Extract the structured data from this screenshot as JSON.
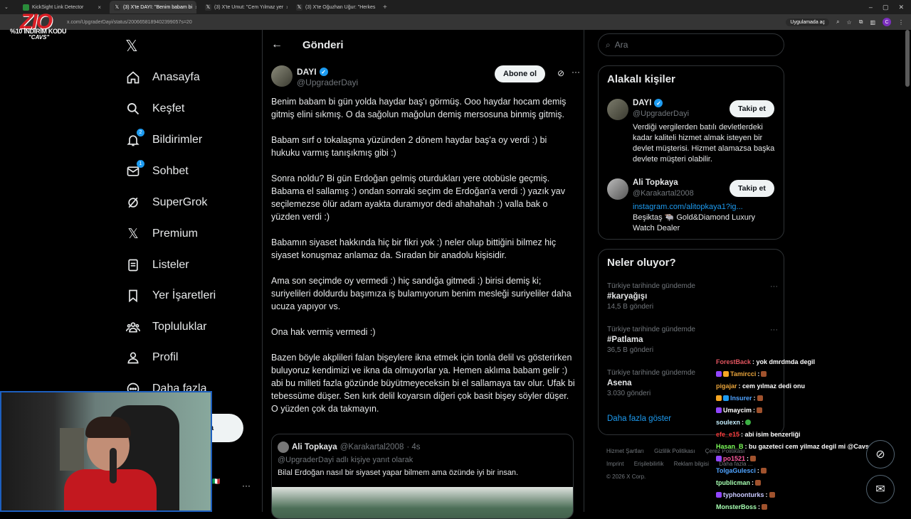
{
  "browser": {
    "tabs": [
      {
        "title": "KickSight Link Detector",
        "active": false
      },
      {
        "title": "(3) X'te DAYI: \"Benim babam bi",
        "active": true
      },
      {
        "title": "(3) X'te Umut: \"Cem Yılmaz yer",
        "active": false
      },
      {
        "title": "(3) X'te Oğuzhan Uğur: \"Herkes",
        "active": false
      }
    ],
    "url": "x.com/UpgraderDayi/status/2006658189402399057s=20",
    "app_button": "Uygulamada aç"
  },
  "overlay_logo": {
    "brand": "ZIO",
    "line1": "%10 İNDİRİM KODU",
    "line2": "\"CAVS\""
  },
  "nav": {
    "items": [
      {
        "label": "Anasayfa",
        "icon": "home-icon"
      },
      {
        "label": "Keşfet",
        "icon": "search-icon"
      },
      {
        "label": "Bildirimler",
        "icon": "bell-icon",
        "badge": "2"
      },
      {
        "label": "Sohbet",
        "icon": "mail-icon",
        "badge": "1"
      },
      {
        "label": "SuperGrok",
        "icon": "grok-icon"
      },
      {
        "label": "Premium",
        "icon": "x-icon"
      },
      {
        "label": "Listeler",
        "icon": "list-icon"
      },
      {
        "label": "Yer İşaretleri",
        "icon": "bookmark-icon"
      },
      {
        "label": "Topluluklar",
        "icon": "communities-icon"
      },
      {
        "label": "Profil",
        "icon": "profile-icon"
      },
      {
        "label": "Daha fazla",
        "icon": "more-icon"
      }
    ],
    "post_button_partial": "a"
  },
  "main": {
    "header_title": "Gönderi",
    "author": {
      "name": "DAYI",
      "handle": "@UpgraderDayi"
    },
    "subscribe_label": "Abone ol",
    "paragraphs": [
      "Benim babam bi gün yolda haydar baş'ı görmüş. Ooo haydar hocam demiş gitmiş elini sıkmış. O da sağolun mağolun demiş mersosuna binmiş gitmiş.",
      "Babam sırf o tokalaşma yüzünden 2 dönem haydar baş'a oy verdi :) bi hukuku varmış tanışıkmış gibi :)",
      "Sonra noldu? Bi gün Erdoğan gelmiş oturdukları yere otobüsle geçmiş. Babama el sallamış :) ondan sonraki seçim de Erdoğan'a verdi :) yazık yav seçilemezse ölür adam ayakta duramıyor dedi ahahahah :) valla bak o yüzden verdi :)",
      "Babamın siyaset hakkında hiç bir fikri yok :) neler olup bittiğini bilmez hiç siyaset konuşmaz anlamaz da. Sıradan bir anadolu kişisidir.",
      "Ama son seçimde oy vermedi :) hiç sandığa gitmedi :) birisi demiş ki; suriyelileri doldurdu başımıza iş bulamıyorum benim mesleği suriyeliler daha ucuza yapıyor vs.",
      "Ona hak vermiş vermedi :)",
      "Bazen böyle akplileri falan bişeylere ikna etmek için tonla delil vs gösterirken buluyoruz kendimizi ve ikna da olmuyorlar ya. Hemen aklıma babam gelir :) abi bu milleti fazla gözünde büyütmeyeceksin bi el sallamaya tav olur. Ufak bi tebessüme düşer. Sen kırk delil koyarsın diğeri çok basit bişey söyler düşer. O yüzden çok da takmayın."
    ],
    "quote": {
      "name": "Ali Topkaya",
      "handle": "@Karakartal2008",
      "time": "· 4s",
      "reply_to": "@UpgraderDayi adlı kişiye yanıt olarak",
      "text": "Bilal Erdoğan nasıl bir siyaset  yapar bilmem ama özünde iyi bir insan."
    }
  },
  "right": {
    "search_placeholder": "Ara",
    "related_title": "Alakalı kişiler",
    "people": [
      {
        "name": "DAYI",
        "handle": "@UpgraderDayi",
        "verified": true,
        "follow": "Takip et",
        "bio": "Verdiği vergilerden batılı devletlerdeki kadar kaliteli hizmet almak isteyen bir devlet müşterisi. Hizmet alamazsa başka devlete müşteri olabilir."
      },
      {
        "name": "Ali Topkaya",
        "handle": "@Karakartal2008",
        "verified": false,
        "follow": "Takip et",
        "link": "instagram.com/alitopkaya1?ig...",
        "bio": "Beşiktaş 🐃 Gold&Diamond Luxury Watch Dealer"
      }
    ],
    "trends_title": "Neler oluyor?",
    "trends": [
      {
        "meta": "Türkiye tarihinde gündemde",
        "name": "#karyağışı",
        "count": "14,5 B gönderi"
      },
      {
        "meta": "Türkiye tarihinde gündemde",
        "name": "#Patlama",
        "count": "36,5 B gönderi"
      },
      {
        "meta": "Türkiye tarihinde gündemde",
        "name": "Asena",
        "count": "3.030 gönderi"
      }
    ],
    "show_more": "Daha fazla göster",
    "footer": [
      "Hizmet Şartları",
      "Gizlilik Politikası",
      "Çerez Politikası",
      "Imprint",
      "Erişilebilirlik",
      "Reklam bilgisi",
      "Daha fazla ...",
      "© 2026 X Corp."
    ]
  },
  "chat": [
    {
      "user": "ForestBack",
      "msg": ": yok dmrdmda degil",
      "color": "#e2555f"
    },
    {
      "user": "Tamircci",
      "msg": " :",
      "color": "#e8a33a"
    },
    {
      "user": "pigajar",
      "msg": ": cem yılmaz dedi onu",
      "color": "#e8a33a"
    },
    {
      "user": "Insurer",
      "msg": " :",
      "color": "#4fa3ff"
    },
    {
      "user": "Umaycim",
      "msg": " :",
      "color": "#ffffff"
    },
    {
      "user": "soulexn",
      "msg": " :",
      "color": "#c6f0ff"
    },
    {
      "user": "efe_e15",
      "msg": ": abi isim benzerliği",
      "color": "#ff4040"
    },
    {
      "user": "Hasan_B",
      "msg": ": bu gazeteci cem yilmaz degil mi @Cavs",
      "color": "#7dff5a"
    },
    {
      "user": "po1521",
      "msg": " :",
      "color": "#ff5aa0"
    },
    {
      "user": "TolgaGulesci",
      "msg": " :",
      "color": "#4fa3ff"
    },
    {
      "user": "tpublicman",
      "msg": " :",
      "color": "#a7ffb2"
    },
    {
      "user": "typhoonturks",
      "msg": " :",
      "color": "#c9c9ff"
    },
    {
      "user": "MonsterBoss",
      "msg": " :",
      "color": "#a7ffb2"
    }
  ],
  "colors": {
    "accent": "#1d9bf0",
    "bg": "#000000",
    "border": "#2f3336",
    "muted": "#71767b"
  }
}
